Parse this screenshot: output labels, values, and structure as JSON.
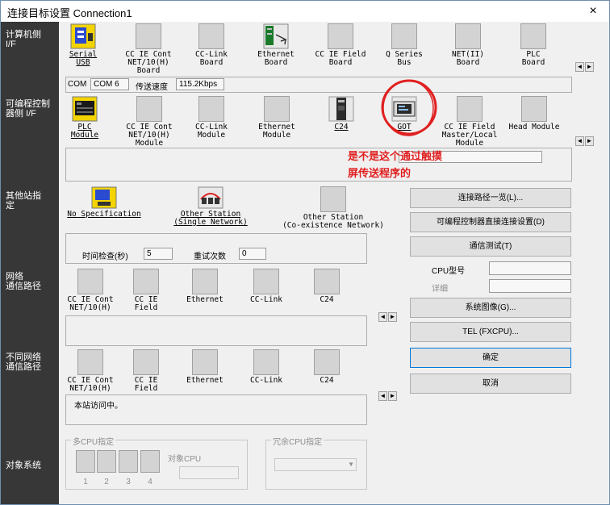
{
  "window": {
    "title": "连接目标设置 Connection1",
    "close_label": "×"
  },
  "sidebar": {
    "pc_side": "计算机侧\nI/F",
    "plc_side": "可编程控制\n器侧 I/F",
    "other_station": "其他站指\n定",
    "network_route": "网络\n通信路径",
    "diff_network_route": "不同网络\n通信路径",
    "target_system": "对象系统"
  },
  "pc_if": {
    "items": [
      {
        "label": "Serial\nUSB",
        "icon": "serial-usb-icon",
        "selected": true
      },
      {
        "label": "CC IE Cont\nNET/10(H)\nBoard",
        "icon": "cc-ie-cont-board-icon"
      },
      {
        "label": "CC-Link\nBoard",
        "icon": "cc-link-board-icon"
      },
      {
        "label": "Ethernet\nBoard",
        "icon": "ethernet-board-icon"
      },
      {
        "label": "CC IE Field\nBoard",
        "icon": "cc-ie-field-board-icon"
      },
      {
        "label": "Q Series\nBus",
        "icon": "q-series-bus-icon"
      },
      {
        "label": "NET(II)\nBoard",
        "icon": "net-ii-board-icon"
      },
      {
        "label": "PLC\nBoard",
        "icon": "plc-board-icon"
      }
    ],
    "com_label": "COM",
    "com_value": "COM 6",
    "speed_label": "传送速度",
    "speed_value": "115.2Kbps"
  },
  "plc_if": {
    "items": [
      {
        "label": "PLC\nModule",
        "icon": "plc-module-icon",
        "selected": true
      },
      {
        "label": "CC IE Cont\nNET/10(H)\nModule",
        "icon": "cc-ie-cont-module-icon"
      },
      {
        "label": "CC-Link\nModule",
        "icon": "cc-link-module-icon"
      },
      {
        "label": "Ethernet\nModule",
        "icon": "ethernet-module-icon"
      },
      {
        "label": "C24",
        "icon": "c24-icon",
        "underlined": true
      },
      {
        "label": "GOT",
        "icon": "got-icon",
        "underlined": true
      },
      {
        "label": "CC IE Field\nMaster/Local\nModule",
        "icon": "cc-ie-field-master-icon"
      },
      {
        "label": "Head Module",
        "icon": "head-module-icon"
      }
    ]
  },
  "annotation": {
    "text": "是不是这个通过触摸\n屏传送程序的",
    "color": "#e02020"
  },
  "other_station": {
    "items": [
      {
        "label": "No Specification",
        "icon": "no-specification-icon",
        "selected": true
      },
      {
        "label": "Other Station\n(Single Network)",
        "icon": "other-station-single-icon"
      },
      {
        "label": "Other Station\n(Co-existence Network)",
        "icon": "other-station-coexistence-icon"
      }
    ],
    "timeout_label": "时间检查(秒)",
    "timeout_value": "5",
    "retry_label": "重试次数",
    "retry_value": "0"
  },
  "network_route": {
    "items": [
      {
        "label": "CC IE Cont\nNET/10(H)",
        "icon": "net-cc-ie-cont-icon"
      },
      {
        "label": "CC IE\nField",
        "icon": "net-cc-ie-field-icon"
      },
      {
        "label": "Ethernet",
        "icon": "net-ethernet-icon"
      },
      {
        "label": "CC-Link",
        "icon": "net-cc-link-icon"
      },
      {
        "label": "C24",
        "icon": "net-c24-icon"
      }
    ]
  },
  "diff_network_route": {
    "items": [
      {
        "label": "CC IE Cont\nNET/10(H)",
        "icon": "diff-cc-ie-cont-icon"
      },
      {
        "label": "CC IE\nField",
        "icon": "diff-cc-ie-field-icon"
      },
      {
        "label": "Ethernet",
        "icon": "diff-ethernet-icon"
      },
      {
        "label": "CC-Link",
        "icon": "diff-cc-link-icon"
      },
      {
        "label": "C24",
        "icon": "diff-c24-icon"
      }
    ],
    "status_text": "本站访问中。"
  },
  "buttons": {
    "route_list": "连接路径一览(L)...",
    "direct_conn": "可编程控制器直接连接设置(D)",
    "comm_test": "通信测试(T)",
    "cpu_type_label": "CPU型号",
    "detail_label": "详细",
    "system_image": "系统图像(G)...",
    "tel": "TEL (FXCPU)...",
    "ok": "确定",
    "cancel": "取消"
  },
  "target_system": {
    "multi_cpu_title": "多CPU指定",
    "cpu_numbers": [
      "1",
      "2",
      "3",
      "4"
    ],
    "target_cpu_label": "对象CPU",
    "redundant_title": "冗余CPU指定"
  },
  "scroll": {
    "left": "◄",
    "right": "►"
  }
}
